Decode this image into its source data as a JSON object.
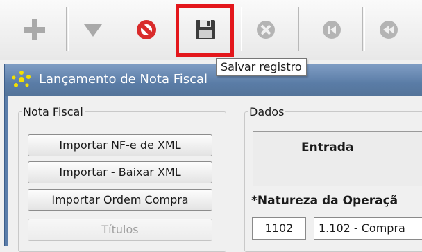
{
  "toolbar": {
    "buttons": [
      {
        "name": "add",
        "icon": "plus-icon",
        "enabled": false
      },
      {
        "name": "dropdown",
        "icon": "triangle-down-icon",
        "enabled": false
      },
      {
        "name": "cancel",
        "icon": "no-entry-icon",
        "enabled": true
      },
      {
        "name": "save",
        "icon": "floppy-disk-icon",
        "enabled": true,
        "highlighted": true
      },
      {
        "name": "delete",
        "icon": "x-circle-icon",
        "enabled": false
      },
      {
        "name": "first",
        "icon": "skip-first-icon",
        "enabled": false
      },
      {
        "name": "previous",
        "icon": "rewind-icon",
        "enabled": false
      }
    ],
    "tooltip": "Salvar registro"
  },
  "window": {
    "title": "Lançamento de Nota Fiscal",
    "title_color": "#5b7da9"
  },
  "nota_fiscal": {
    "legend": "Nota Fiscal",
    "buttons": [
      {
        "label": "Importar NF-e de XML",
        "enabled": true
      },
      {
        "label": "Importar - Baixar XML",
        "enabled": true
      },
      {
        "label": "Importar Ordem Compra",
        "enabled": true
      },
      {
        "label": "Títulos",
        "enabled": false
      }
    ]
  },
  "dados": {
    "legend": "Dados",
    "tipo": "Entrada",
    "natureza_label": "*Natureza da Operaçã",
    "natureza_code": "1102",
    "natureza_desc": "1.102 - Compra"
  },
  "colors": {
    "highlight": "#e3161b",
    "cancel_red": "#d92b2b"
  }
}
